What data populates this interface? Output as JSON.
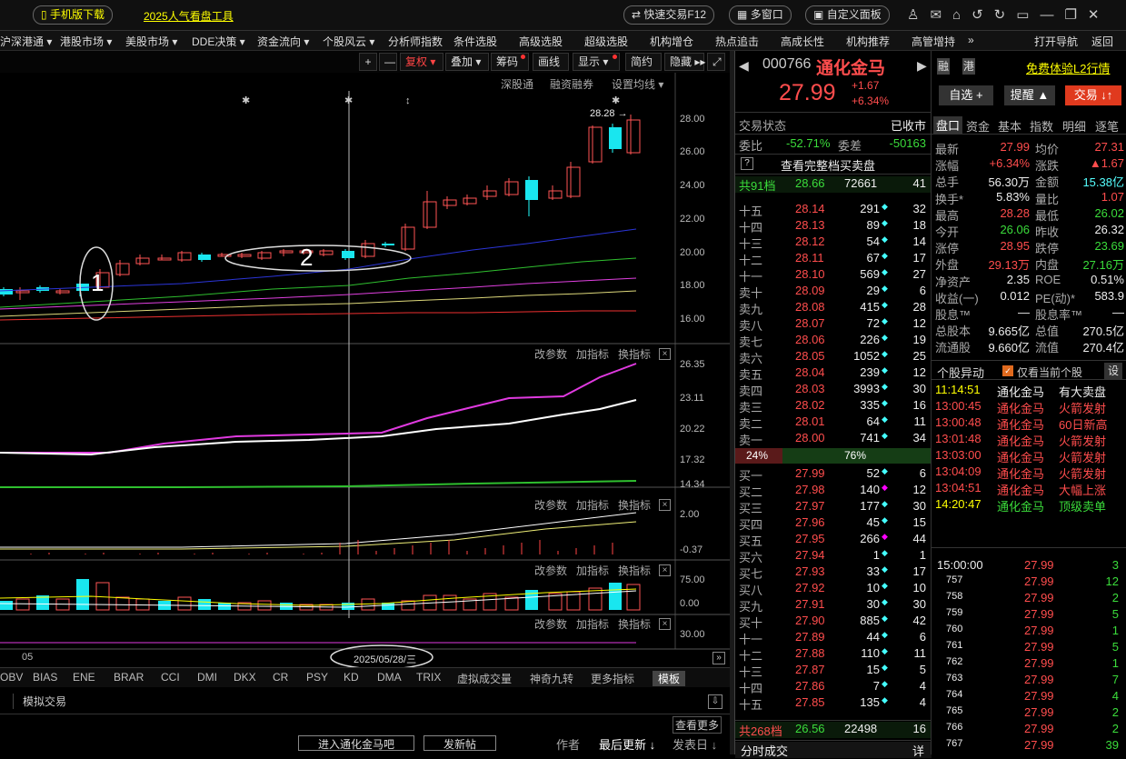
{
  "topbar": {
    "mobile": "手机版下载",
    "promo": "2025人气看盘工具",
    "quick_trade": "快速交易F12",
    "multi_window": "多窗口",
    "custom_panel": "自定义面板"
  },
  "menu": [
    "沪深港通 ▾",
    "港股市场 ▾",
    "美股市场 ▾",
    "DDE决策 ▾",
    "资金流向 ▾",
    "个股风云 ▾",
    "分析师指数",
    "条件选股",
    "高级选股",
    "超级选股",
    "机构增仓",
    "热点追击",
    "高成长性",
    "机构推荐",
    "高管增持",
    "»",
    "打开导航",
    "返回"
  ],
  "toolbar": {
    "plus": "+",
    "minus": "—",
    "fuquan": "复权 ▾",
    "overlay": "叠加 ▾",
    "chips": "筹码",
    "draw": "画线",
    "display": "显示 ▾",
    "simple": "简约",
    "hide": "隐藏 ▸▸"
  },
  "subtoolbar": {
    "sgt": "深股通",
    "margin": "融资融券",
    "ma_setting": "设置均线 ▾"
  },
  "price_axis": [
    "28.00",
    "26.00",
    "24.00",
    "22.00",
    "20.00",
    "18.00",
    "16.00"
  ],
  "annot": {
    "high": "28.28",
    "one": "1",
    "two": "2",
    "date": "2025/05/28/三",
    "month": "05"
  },
  "sub1": {
    "axis": [
      "26.35",
      "23.11",
      "20.22",
      "17.32",
      "14.34"
    ]
  },
  "sub2": {
    "axis": [
      "2.00",
      "-0.37"
    ]
  },
  "sub3": {
    "axis": [
      "75.00",
      "0.00"
    ]
  },
  "sub4": {
    "axis": [
      "30.00"
    ]
  },
  "sub_actions": {
    "change": "改参数",
    "add": "加指标",
    "switch": "换指标",
    "close": "×"
  },
  "indicators": [
    "OBV",
    "BIAS",
    "ENE",
    "BRAR",
    "CCI",
    "DMI",
    "DKX",
    "CR",
    "PSY",
    "KD",
    "DMA",
    "TRIX",
    "虚拟成交量",
    "神奇九转",
    "更多指标",
    "模板"
  ],
  "bottom": {
    "sim": "模拟交易",
    "more": "查看更多",
    "enter_bar": "进入通化金马吧",
    "post": "发新帖",
    "author": "作者",
    "last_update": "最后更新 ↓",
    "post_date": "发表日 ↓"
  },
  "stock": {
    "code": "000766",
    "name": "通化金马",
    "price": "27.99",
    "chg": "+1.67",
    "pct": "+6.34%",
    "rong": "融",
    "gang": "港",
    "l2": "免费体验L2行情",
    "zixuan": "自选 +",
    "tixing": "提醒 ▲",
    "jiaoyi": "交易 ↓↑"
  },
  "status": {
    "label": "交易状态",
    "value": "已收市"
  },
  "weibi": {
    "label": "委比",
    "value": "-52.71%",
    "label2": "委差",
    "value2": "-50163"
  },
  "full_book": "查看完整档买卖盘",
  "sell_total": {
    "label": "共91档",
    "price": "28.66",
    "vol": "72661",
    "n": "41"
  },
  "asks": [
    [
      "十五",
      "28.14",
      "291",
      "32"
    ],
    [
      "十四",
      "28.13",
      "89",
      "18"
    ],
    [
      "十三",
      "28.12",
      "54",
      "14"
    ],
    [
      "十二",
      "28.11",
      "67",
      "17"
    ],
    [
      "十一",
      "28.10",
      "569",
      "27"
    ],
    [
      "卖十",
      "28.09",
      "29",
      "6"
    ],
    [
      "卖九",
      "28.08",
      "415",
      "28"
    ],
    [
      "卖八",
      "28.07",
      "72",
      "12"
    ],
    [
      "卖七",
      "28.06",
      "226",
      "19"
    ],
    [
      "卖六",
      "28.05",
      "1052",
      "25"
    ],
    [
      "卖五",
      "28.04",
      "239",
      "12"
    ],
    [
      "卖四",
      "28.03",
      "3993",
      "30"
    ],
    [
      "卖三",
      "28.02",
      "335",
      "16"
    ],
    [
      "卖二",
      "28.01",
      "64",
      "11"
    ],
    [
      "卖一",
      "28.00",
      "741",
      "34"
    ]
  ],
  "ratio": {
    "left": "24%",
    "right": "76%"
  },
  "bids": [
    [
      "买一",
      "27.99",
      "52",
      "6"
    ],
    [
      "买二",
      "27.98",
      "140",
      "12"
    ],
    [
      "买三",
      "27.97",
      "177",
      "30"
    ],
    [
      "买四",
      "27.96",
      "45",
      "15"
    ],
    [
      "买五",
      "27.95",
      "266",
      "44"
    ],
    [
      "买六",
      "27.94",
      "1",
      "1"
    ],
    [
      "买七",
      "27.93",
      "33",
      "17"
    ],
    [
      "买八",
      "27.92",
      "10",
      "10"
    ],
    [
      "买九",
      "27.91",
      "30",
      "30"
    ],
    [
      "买十",
      "27.90",
      "885",
      "42"
    ],
    [
      "十一",
      "27.89",
      "44",
      "6"
    ],
    [
      "十二",
      "27.88",
      "110",
      "11"
    ],
    [
      "十三",
      "27.87",
      "15",
      "5"
    ],
    [
      "十四",
      "27.86",
      "7",
      "4"
    ],
    [
      "十五",
      "27.85",
      "135",
      "4"
    ]
  ],
  "buy_total": {
    "label": "共268档",
    "price": "26.56",
    "vol": "22498",
    "n": "16"
  },
  "fenshi": {
    "label": "分时成交",
    "detail": "详"
  },
  "tabs": [
    "盘口",
    "资金",
    "基本",
    "指数",
    "明细",
    "逐笔"
  ],
  "quote": [
    [
      "最新",
      "27.99",
      "均价",
      "27.31"
    ],
    [
      "涨幅",
      "+6.34%",
      "涨跌",
      "▲1.67"
    ],
    [
      "总手",
      "56.30万",
      "金额",
      "15.38亿"
    ],
    [
      "换手*",
      "5.83%",
      "量比",
      "1.07"
    ],
    [
      "最高",
      "28.28",
      "最低",
      "26.02"
    ],
    [
      "今开",
      "26.06",
      "昨收",
      "26.32"
    ],
    [
      "涨停",
      "28.95",
      "跌停",
      "23.69"
    ],
    [
      "外盘",
      "29.13万",
      "内盘",
      "27.16万"
    ],
    [
      "净资产",
      "2.35",
      "ROE",
      "0.51%"
    ],
    [
      "收益(一)",
      "0.012",
      "PE(动)*",
      "583.9"
    ],
    [
      "股息™",
      "—",
      "股息率™",
      "—"
    ],
    [
      "总股本",
      "9.665亿",
      "总值",
      "270.5亿"
    ],
    [
      "流通股",
      "9.660亿",
      "流值",
      "270.4亿"
    ]
  ],
  "alerts_head": {
    "title": "个股异动",
    "only": "仅看当前个股",
    "set": "设"
  },
  "alerts": [
    [
      "11:14:51",
      "通化金马",
      "有大卖盘"
    ],
    [
      "13:00:45",
      "通化金马",
      "火箭发射"
    ],
    [
      "13:00:48",
      "通化金马",
      "60日新高"
    ],
    [
      "13:01:48",
      "通化金马",
      "火箭发射"
    ],
    [
      "13:03:00",
      "通化金马",
      "火箭发射"
    ],
    [
      "13:04:09",
      "通化金马",
      "火箭发射"
    ],
    [
      "13:04:51",
      "通化金马",
      "大幅上涨"
    ],
    [
      "14:20:47",
      "通化金马",
      "顶级卖单"
    ]
  ],
  "ticks": [
    [
      "15:00:00",
      "27.99",
      "3"
    ],
    [
      "757",
      "27.99",
      "12"
    ],
    [
      "758",
      "27.99",
      "2"
    ],
    [
      "759",
      "27.99",
      "5"
    ],
    [
      "760",
      "27.99",
      "1"
    ],
    [
      "761",
      "27.99",
      "5"
    ],
    [
      "762",
      "27.99",
      "1"
    ],
    [
      "763",
      "27.99",
      "7"
    ],
    [
      "764",
      "27.99",
      "4"
    ],
    [
      "765",
      "27.99",
      "2"
    ],
    [
      "766",
      "27.99",
      "2"
    ],
    [
      "767",
      "27.99",
      "39"
    ]
  ]
}
